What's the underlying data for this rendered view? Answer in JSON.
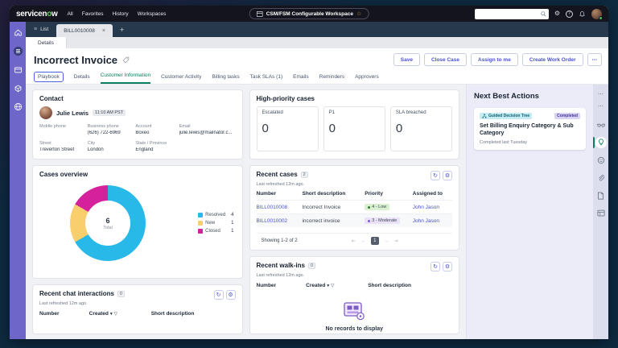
{
  "colors": {
    "frame": "#0e2a40",
    "accent_indigo": "#4a53c8",
    "active_tab_green": "#0b7d60",
    "sidebar_purple": "#6f66c9",
    "nba_panel_bg": "#ebecf7",
    "priority_low_bg": "#d9f1d1",
    "priority_moderate_bg": "#eae2f8"
  },
  "icons": {
    "star": "☆",
    "hamburger": "≡",
    "close": "×",
    "plus": "+",
    "ellipsis": "⋯",
    "refresh": "↻",
    "gear": "⚙",
    "sort_caret": "▾",
    "filter": "▽",
    "help": "?",
    "page_first": "⇤",
    "page_prev": "←",
    "page_next": "→",
    "page_last": "⇥"
  },
  "top_nav": {
    "logo_prefix": "servicen",
    "logo_accent": "o",
    "logo_suffix": "w",
    "menu": [
      "All",
      "Favorites",
      "History",
      "Workspaces"
    ],
    "workspace_pill": "CSM/FSM Configurable Workspace",
    "search_placeholder": ""
  },
  "tab_strip": {
    "list_label": "List",
    "record_tab": "BILL0010008"
  },
  "sub_tab": {
    "details": "Details"
  },
  "record_header": {
    "title": "Incorrect Invoice",
    "buttons": [
      "Save",
      "Close Case",
      "Assign to me",
      "Create Work Order"
    ],
    "tabs": [
      "Playbook",
      "Details",
      "Customer Information",
      "Customer Activity",
      "Billing tasks",
      "Task SLAs (1)",
      "Emails",
      "Reminders",
      "Approvers"
    ]
  },
  "contact": {
    "title": "Contact",
    "name": "Julie Lewis",
    "time_badge": "11:10 AM PST",
    "fields": [
      {
        "label": "Mobile phone",
        "value": ""
      },
      {
        "label": "Business phone",
        "value": "(626) 722-6969"
      },
      {
        "label": "Account",
        "value": "Boxeo"
      },
      {
        "label": "Email",
        "value": "julie.lewis@mailnator.c..."
      },
      {
        "label": "Street",
        "value": "Treverton Street"
      },
      {
        "label": "City",
        "value": "London"
      },
      {
        "label": "State / Province",
        "value": "England"
      }
    ]
  },
  "high_priority": {
    "title": "High-priority cases",
    "cards": [
      {
        "label": "Escalated",
        "value": "0"
      },
      {
        "label": "P1",
        "value": "0"
      },
      {
        "label": "SLA breached",
        "value": "0"
      }
    ]
  },
  "cases_overview": {
    "title": "Cases overview",
    "total": "6",
    "total_label": "Total",
    "legend": [
      {
        "label": "Resolved",
        "value": "4",
        "color": "#29b9e8"
      },
      {
        "label": "New",
        "value": "1",
        "color": "#f9cf6e"
      },
      {
        "label": "Closed",
        "value": "1",
        "color": "#d6219c"
      }
    ]
  },
  "chart_data": {
    "type": "pie",
    "title": "Cases overview",
    "categories": [
      "Resolved",
      "New",
      "Closed"
    ],
    "values": [
      4,
      1,
      1
    ],
    "colors": [
      "#29b9e8",
      "#f9cf6e",
      "#d6219c"
    ],
    "total": 6,
    "center_label": "6 Total",
    "legend_position": "right"
  },
  "recent_cases": {
    "title": "Recent cases",
    "badge": "2",
    "refreshed": "Last refreshed 12m ago.",
    "columns": [
      "Number",
      "Short description",
      "Priority",
      "Assigned to"
    ],
    "rows": [
      {
        "number": "BILL0010008",
        "description": "Incorrect Invoice",
        "priority": "4 - Low",
        "assigned_to": "John Jason"
      },
      {
        "number": "BILL0010002",
        "description": "incorrect invoice",
        "priority": "3 - Moderate",
        "assigned_to": "John Jason"
      }
    ],
    "pagination": {
      "summary": "Showing 1-2 of 2",
      "page": "1"
    }
  },
  "recent_walkins": {
    "title": "Recent walk-ins",
    "badge": "0",
    "refreshed": "Last refreshed 12m ago.",
    "columns": [
      "Number",
      "Created",
      "Short description"
    ],
    "empty_text": "No records to display"
  },
  "recent_chat": {
    "title": "Recent chat interactions",
    "badge": "0",
    "refreshed": "Last refreshed 12m ago.",
    "columns": [
      "Number",
      "Created",
      "Short description"
    ]
  },
  "next_best_actions": {
    "title": "Next Best Actions",
    "card": {
      "type_badge": "Guided Decision Tree",
      "status_badge": "Completed",
      "title": "Set Billing Enquiry Category & Sub Category",
      "subtitle": "Completed last Tuesday"
    }
  }
}
